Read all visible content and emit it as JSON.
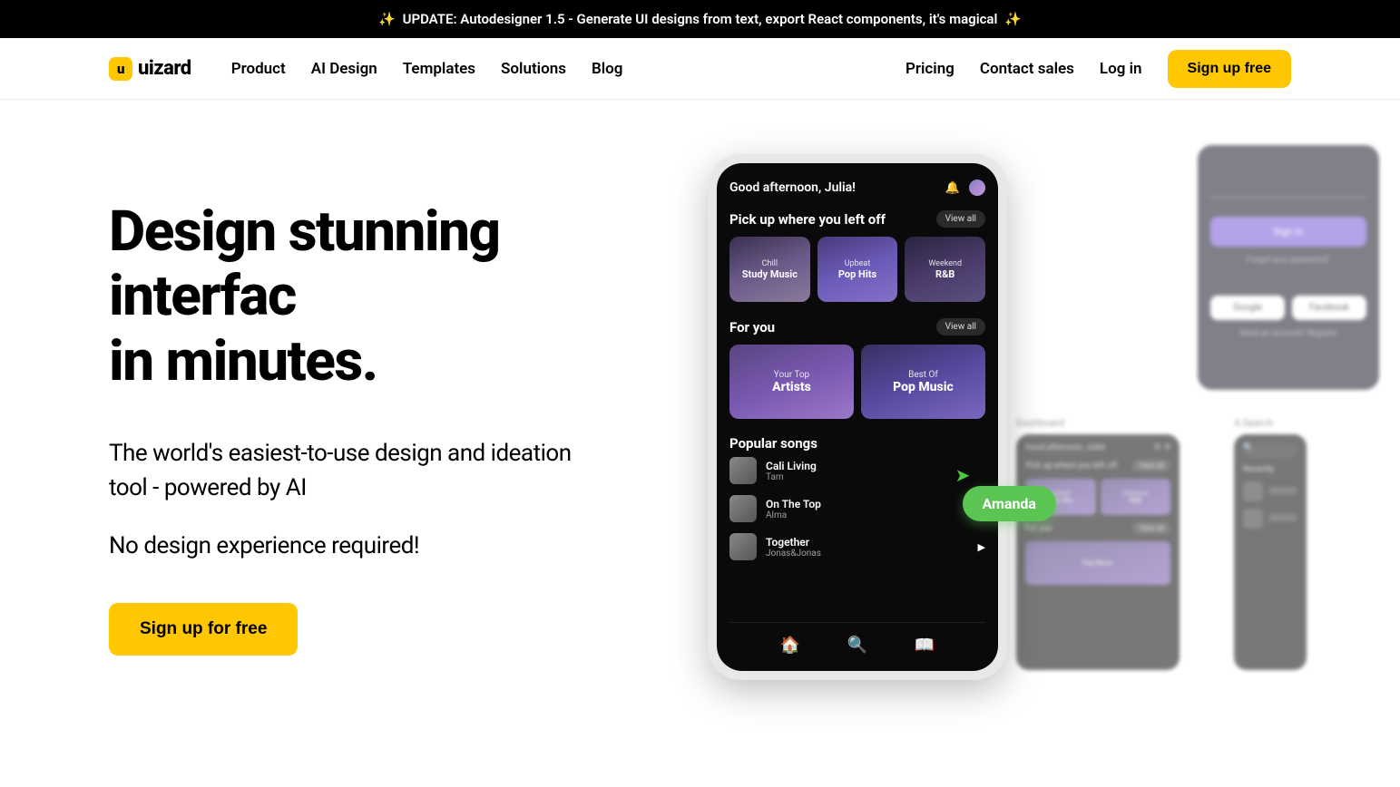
{
  "banner": {
    "text": "UPDATE: Autodesigner 1.5 - Generate UI designs from text, export React components, it's magical",
    "sparkle": "✨"
  },
  "brand": {
    "name": "uizard",
    "icon_letter": "u"
  },
  "nav": {
    "product": "Product",
    "ai_design": "AI Design",
    "templates": "Templates",
    "solutions": "Solutions",
    "blog": "Blog",
    "pricing": "Pricing",
    "contact": "Contact sales",
    "login": "Log in",
    "signup": "Sign up free"
  },
  "hero": {
    "title_l1": "Design stunning",
    "title_l2": "interfac",
    "title_l3": "in minutes.",
    "sub": "The world's easiest-to-use design and ideation tool - powered by AI",
    "sub2": "No design experience required!",
    "cta": "Sign up for free"
  },
  "cursor": {
    "label": "Amanda"
  },
  "phone": {
    "greeting": "Good afternoon, Julia!",
    "sec1": "Pick up where you left off",
    "viewall": "View all",
    "cards3": [
      {
        "top": "Chill",
        "bot": "Study Music"
      },
      {
        "top": "Upbeat",
        "bot": "Pop Hits"
      },
      {
        "top": "Weekend",
        "bot": "R&B"
      }
    ],
    "sec2": "For you",
    "cards2": [
      {
        "top": "Your Top",
        "bot": "Artists"
      },
      {
        "top": "Best Of",
        "bot": "Pop Music"
      }
    ],
    "sec3": "Popular songs",
    "songs": [
      {
        "title": "Cali Living",
        "artist": "Tam"
      },
      {
        "title": "On The Top",
        "artist": "Alma"
      },
      {
        "title": "Together",
        "artist": "Jonas&Jonas"
      }
    ]
  },
  "mocks": {
    "signin": "Sign in",
    "forgot": "Forgot your password?",
    "google": "Google",
    "facebook": "Facebook",
    "need": "Need an account? Register",
    "dashboard": "Dashboard",
    "search_label": "4.Search",
    "mini_greeting": "Good afternoon, Julia!",
    "mini_sec": "Pick up where you left off",
    "mini_cards": [
      {
        "top": "Upbeat",
        "bot": "Pop Hits"
      },
      {
        "top": "Weekend",
        "bot": "R&B"
      }
    ],
    "mini_foryou": "For you",
    "mini_pop": "Pop Music",
    "recent": "Recently"
  }
}
